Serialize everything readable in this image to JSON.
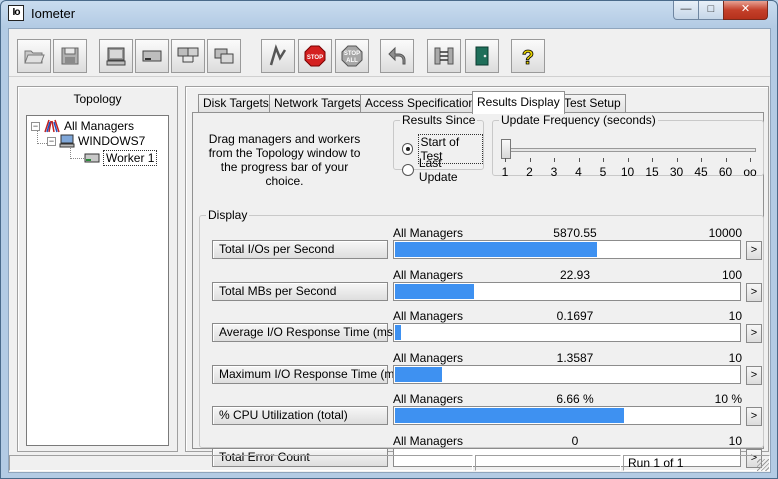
{
  "window": {
    "title": "Iometer",
    "icon_text": "Io"
  },
  "title_buttons": {
    "minimize": "—",
    "maximize": "□",
    "close": "✕"
  },
  "toolbar": {
    "stop_label": "STOP",
    "stop_all_label_1": "STOP",
    "stop_all_label_2": "ALL",
    "help_label": "?"
  },
  "topology": {
    "title": "Topology",
    "tree": [
      {
        "label": "All Managers",
        "expander": "−"
      },
      {
        "label": "WINDOWS7",
        "expander": "−"
      },
      {
        "label": "Worker 1"
      }
    ]
  },
  "tabs": [
    {
      "label": "Disk Targets"
    },
    {
      "label": "Network Targets"
    },
    {
      "label": "Access Specifications"
    },
    {
      "label": "Results Display",
      "active": true
    },
    {
      "label": "Test Setup"
    }
  ],
  "instructions": "Drag managers and workers from the Topology window to the progress bar of your choice.",
  "results_since": {
    "legend": "Results Since",
    "options": [
      {
        "label": "Start of Test",
        "selected": true
      },
      {
        "label": "Last Update",
        "selected": false
      }
    ]
  },
  "update_frequency": {
    "legend": "Update Frequency (seconds)",
    "ticks": [
      "1",
      "2",
      "3",
      "4",
      "5",
      "10",
      "15",
      "30",
      "45",
      "60",
      "oo"
    ],
    "selected_index": 0
  },
  "display": {
    "legend": "Display",
    "more_label": ">",
    "metrics": [
      {
        "button": "Total I/Os per Second",
        "source": "All Managers",
        "value": "5870.55",
        "max": "10000",
        "fraction": 0.5871
      },
      {
        "button": "Total MBs per Second",
        "source": "All Managers",
        "value": "22.93",
        "max": "100",
        "fraction": 0.2293
      },
      {
        "button": "Average I/O Response Time (ms)",
        "source": "All Managers",
        "value": "0.1697",
        "max": "10",
        "fraction": 0.017
      },
      {
        "button": "Maximum I/O Response Time (ms)",
        "source": "All Managers",
        "value": "1.3587",
        "max": "10",
        "fraction": 0.1359
      },
      {
        "button": "% CPU Utilization (total)",
        "source": "All Managers",
        "value": "6.66 %",
        "max": "10 %",
        "fraction": 0.666
      },
      {
        "button": "Total Error Count",
        "source": "All Managers",
        "value": "0",
        "max": "10",
        "fraction": 0
      }
    ]
  },
  "status": {
    "run": "Run 1 of 1"
  }
}
